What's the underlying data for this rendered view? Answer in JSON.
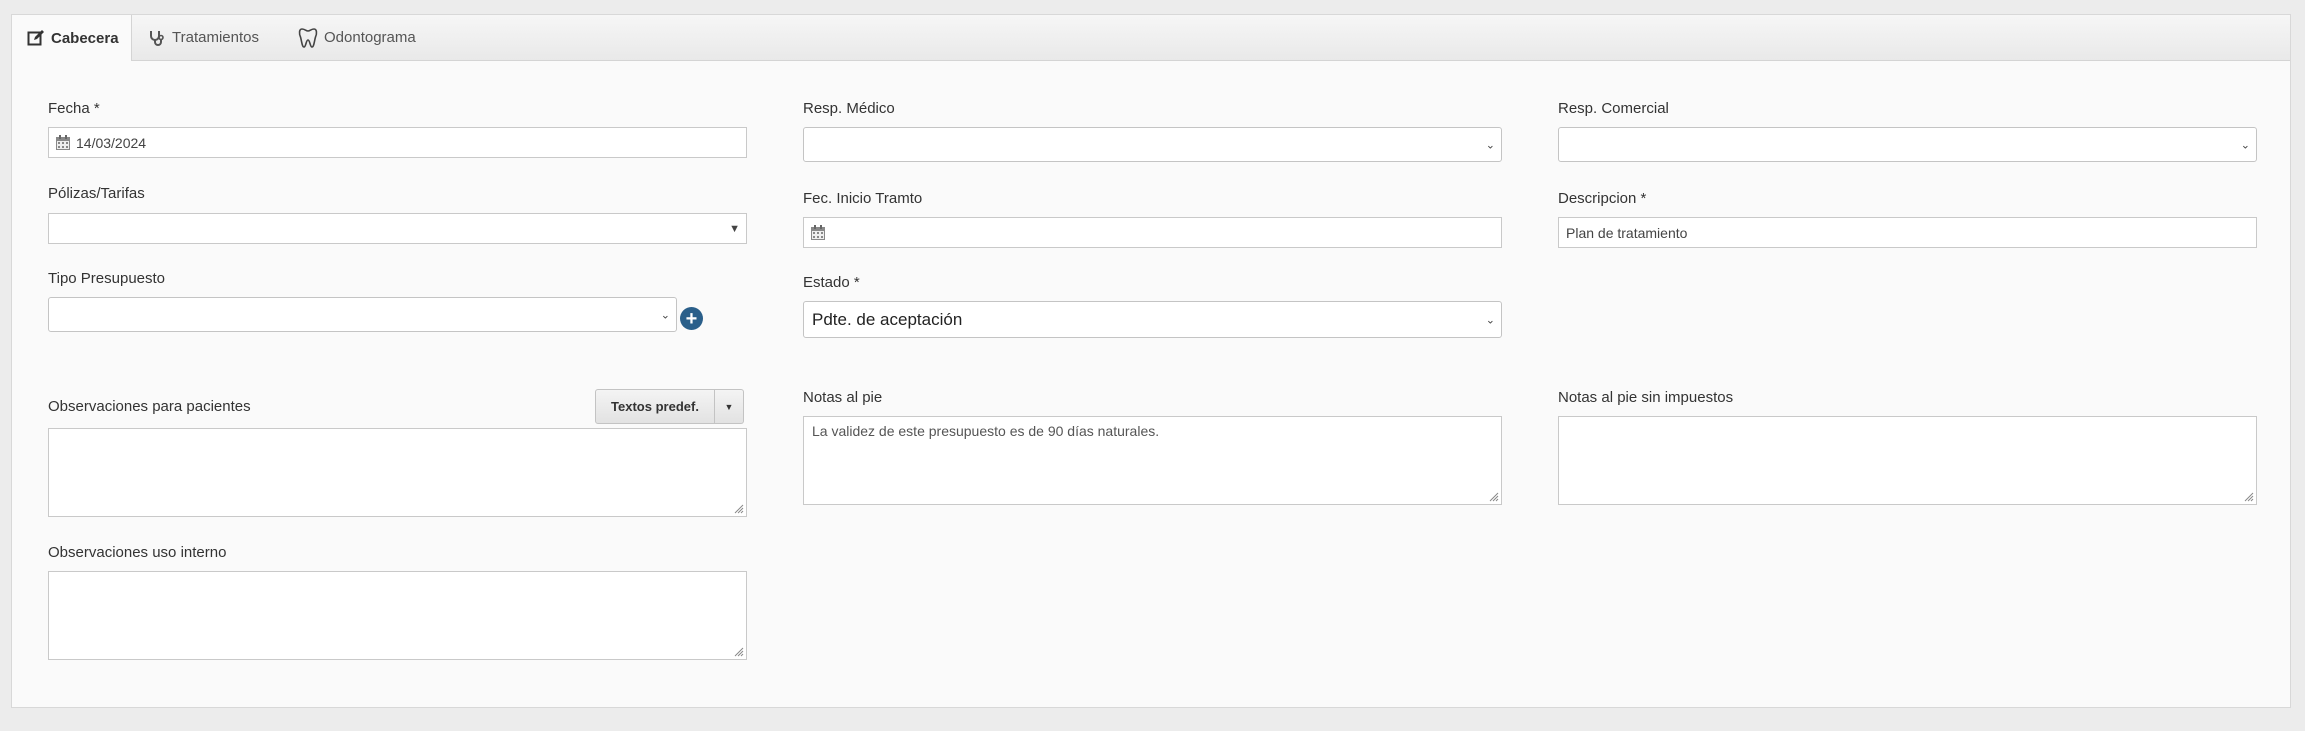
{
  "tabs": [
    {
      "label": "Cabecera",
      "icon": "edit-icon",
      "active": true
    },
    {
      "label": "Tratamientos",
      "icon": "stethoscope-icon",
      "active": false
    },
    {
      "label": "Odontograma",
      "icon": "tooth-icon",
      "active": false
    }
  ],
  "form": {
    "fecha": {
      "label": "Fecha *",
      "value": "14/03/2024"
    },
    "polizas": {
      "label": "Pólizas/Tarifas",
      "value": ""
    },
    "tipo_presupuesto": {
      "label": "Tipo Presupuesto",
      "value": ""
    },
    "obs_pacientes": {
      "label": "Observaciones para pacientes",
      "value": "",
      "textos_predef": "Textos predef."
    },
    "obs_interno": {
      "label": "Observaciones uso interno",
      "value": ""
    },
    "resp_medico": {
      "label": "Resp. Médico",
      "value": ""
    },
    "fec_inicio": {
      "label": "Fec. Inicio Tramto",
      "value": ""
    },
    "estado": {
      "label": "Estado *",
      "value": "Pdte. de aceptación"
    },
    "notas_pie": {
      "label": "Notas al pie",
      "value": "La validez de este presupuesto es de 90 días naturales."
    },
    "resp_comercial": {
      "label": "Resp. Comercial",
      "value": ""
    },
    "descripcion": {
      "label": "Descripcion *",
      "value": "Plan de tratamiento"
    },
    "notas_pie_sin_imp": {
      "label": "Notas al pie sin impuestos",
      "value": ""
    }
  },
  "colors": {
    "add_button": "#2a5f8a"
  }
}
